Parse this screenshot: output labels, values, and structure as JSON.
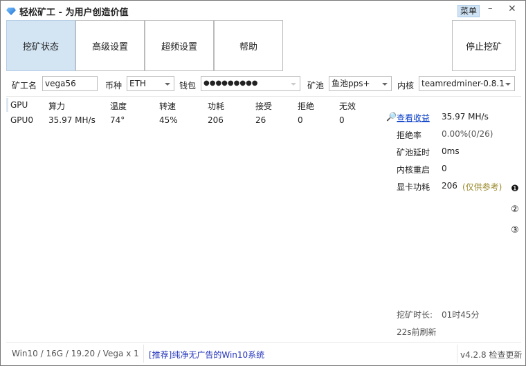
{
  "window": {
    "title": "轻松矿工 - 为用户创造价值",
    "menu_label": "菜单",
    "minimize": "–",
    "close": "✕"
  },
  "tabs": [
    {
      "label": "挖矿状态",
      "active": true
    },
    {
      "label": "高级设置"
    },
    {
      "label": "超频设置"
    },
    {
      "label": "帮助"
    }
  ],
  "stop_label": "停止挖矿",
  "form": {
    "miner_name_label": "矿工名",
    "miner_name": "vega56",
    "coin_label": "币种",
    "coin": "ETH",
    "wallet_label": "钱包",
    "wallet": "●●●●●●●●●",
    "pool_label": "矿池",
    "pool": "鱼池pps+",
    "kernel_label": "内核",
    "kernel": "teamredminer-0.8.1"
  },
  "table": {
    "headers": [
      "GPU",
      "算力",
      "温度",
      "转速",
      "功耗",
      "接受",
      "拒绝",
      "无效"
    ],
    "rows": [
      [
        "GPU0",
        "35.97 MH/s",
        "74°",
        "45%",
        "206",
        "26",
        "0",
        "0"
      ]
    ]
  },
  "stats": {
    "view_earnings": "查看收益",
    "hashrate": "35.97 MH/s",
    "reject_label": "拒绝率",
    "reject": "0.00%(0/26)",
    "latency_label": "矿池延时",
    "latency": "0ms",
    "restart_label": "内核重启",
    "restart": "0",
    "power_label": "显卡功耗",
    "power": "206",
    "power_note": "(仅供参考)"
  },
  "pages": [
    "❶",
    "②",
    "③"
  ],
  "duration_label": "挖矿时长:",
  "duration": "01时45分",
  "refresh": "22s前刷新",
  "status": {
    "system": "Win10  / 16G / 19.20 / Vega x 1",
    "ad": "[推荐]纯净无广告的Win10系统",
    "version": "v4.2.8 检查更新"
  },
  "colors": {
    "active_tab": "#d3e4f3",
    "link": "#0a3fc8"
  }
}
